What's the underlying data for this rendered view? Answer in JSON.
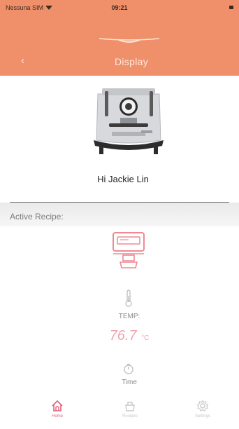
{
  "status_bar": {
    "carrier": "Nessuna SIM",
    "time": "09:21"
  },
  "header": {
    "title": "Display",
    "back_icon": "chevron-left-icon",
    "logo_icon": "brand-wing-logo",
    "background_color": "#f0906a"
  },
  "profile": {
    "machine_image": "espresso-machine-photo",
    "greeting": "Hi Jackie Lin"
  },
  "active_recipe": {
    "section_label": "Active Recipe:",
    "machine_icon": "espresso-machine-outline-icon",
    "temperature": {
      "icon": "thermometer-icon",
      "label": "TEMP:",
      "value": "76.7",
      "unit": "°C"
    },
    "time": {
      "icon": "timer-icon",
      "label": "Time"
    },
    "accent_color": "#f1a3ad"
  },
  "tab_bar": {
    "tabs": [
      {
        "label": "Home",
        "icon": "home-icon",
        "active": true
      },
      {
        "label": "Recipes",
        "icon": "recipe-icon",
        "active": false
      },
      {
        "label": "Settings",
        "icon": "gear-icon",
        "active": false
      }
    ],
    "active_color": "#e2607a",
    "inactive_color": "#c8c8c8"
  }
}
